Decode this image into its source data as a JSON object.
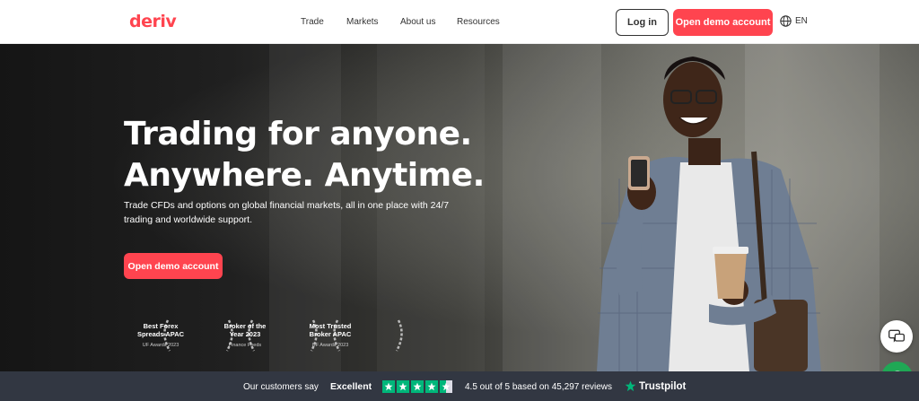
{
  "header": {
    "logo": "deriv",
    "nav": [
      "Trade",
      "Markets",
      "About us",
      "Resources"
    ],
    "login_label": "Log in",
    "demo_label": "Open demo account",
    "language": "EN"
  },
  "hero": {
    "title_line1": "Trading for anyone.",
    "title_line2": "Anywhere. Anytime.",
    "subtitle": "Trade CFDs and options on global financial markets, all in one place with 24/7 trading and worldwide support.",
    "cta_label": "Open demo account",
    "awards": [
      {
        "line1": "Best Forex",
        "line2": "Spreads APAC",
        "source": "UF Awards 2023"
      },
      {
        "line1": "Broker of the",
        "line2": "Year 2023",
        "source": "Finance Feeds"
      },
      {
        "line1": "Most Trusted",
        "line2": "Broker APAC",
        "source": "UF Awards 2023"
      }
    ]
  },
  "trustbar": {
    "say": "Our customers say",
    "excellent": "Excellent",
    "rating_text": "4.5 out of 5 based on 45,297 reviews",
    "brand": "Trustpilot",
    "stars": 4.5
  },
  "colors": {
    "brand": "#ff444f",
    "trustpilot_green": "#00b67a",
    "trustbar_bg": "#323742",
    "whatsapp": "#1fa855"
  },
  "icons": [
    "globe-icon",
    "star-icon",
    "laurel-icon",
    "chat-icon",
    "whatsapp-icon",
    "trustpilot-star-icon"
  ]
}
